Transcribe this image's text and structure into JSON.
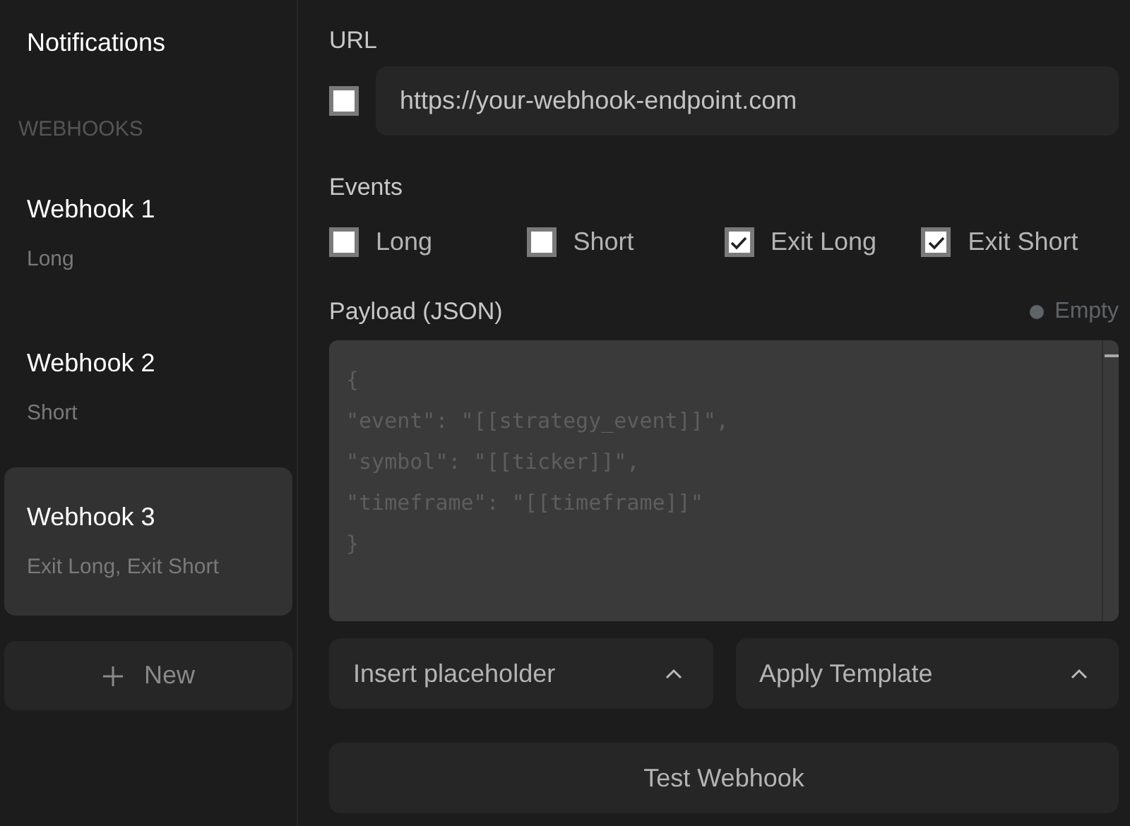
{
  "sidebar": {
    "title": "Notifications",
    "section": "WEBHOOKS",
    "items": [
      {
        "name": "Webhook 1",
        "events": "Long",
        "selected": false
      },
      {
        "name": "Webhook 2",
        "events": "Short",
        "selected": false
      },
      {
        "name": "Webhook 3",
        "events": "Exit Long, Exit Short",
        "selected": true
      }
    ],
    "new_button": "New"
  },
  "url": {
    "label": "URL",
    "checked": false,
    "value": "https://your-webhook-endpoint.com"
  },
  "events": {
    "label": "Events",
    "items": [
      {
        "label": "Long",
        "checked": false
      },
      {
        "label": "Short",
        "checked": false
      },
      {
        "label": "Exit Long",
        "checked": true
      },
      {
        "label": "Exit Short",
        "checked": true
      }
    ]
  },
  "payload": {
    "label": "Payload (JSON)",
    "status": {
      "text": "Empty",
      "color": "#5f6468"
    },
    "placeholder_lines": [
      "{",
      "\"event\": \"[[strategy_event]]\",",
      "\"symbol\": \"[[ticker]]\",",
      "\"timeframe\": \"[[timeframe]]\"",
      "}"
    ]
  },
  "dropdowns": [
    {
      "label": "Insert placeholder",
      "expanded": true
    },
    {
      "label": "Apply Template",
      "expanded": true
    }
  ],
  "test_button": "Test Webhook"
}
